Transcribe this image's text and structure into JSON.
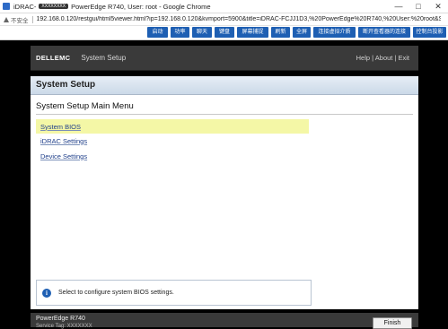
{
  "browser": {
    "tab_prefix": "iDRAC-",
    "tab_tag": "XXXXXXXX",
    "window_title": "PowerEdge R740, User: root - Google Chrome",
    "security_label": "不安全",
    "url": "192.168.0.120/restgui/html5viewer.html?ip=192.168.0.120&kvmport=5900&title=iDRAC-FCJJ1D3,%20PowerEdge%20R740,%20User:%20root&ST1=1..."
  },
  "kvm_toolbar": {
    "buttons": [
      "启动",
      "功率",
      "聊天",
      "键盘",
      "屏幕捕捉",
      "刷新",
      "全屏",
      "连接虚拟介质",
      "断开查看器的连接",
      "控制台投影"
    ]
  },
  "dell_header": {
    "logo": "DELLEMC",
    "title": "System Setup",
    "links": "Help | About | Exit"
  },
  "panel": {
    "title": "System Setup",
    "menu_title": "System Setup Main Menu",
    "items": [
      {
        "label": "System BIOS"
      },
      {
        "label": "iDRAC Settings"
      },
      {
        "label": "Device Settings"
      }
    ],
    "info_icon": "i",
    "info_text": "Select to configure system BIOS settings."
  },
  "footer": {
    "model": "PowerEdge R740",
    "sub": "Service Tag: XXXXXXX",
    "finish_label": "Finish"
  }
}
